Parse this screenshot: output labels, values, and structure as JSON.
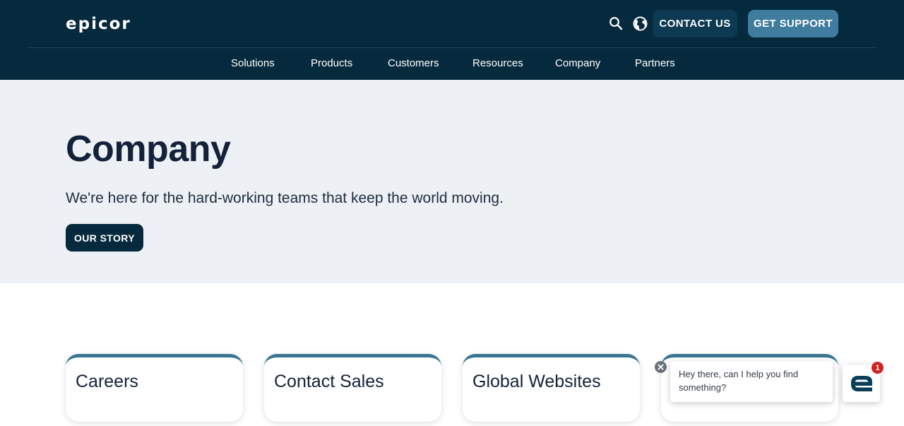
{
  "header": {
    "logo_text": "epicor",
    "contact_label": "CONTACT US",
    "support_label": "GET SUPPORT",
    "search_icon": "search-icon",
    "globe_icon": "globe-icon"
  },
  "nav": {
    "items": [
      {
        "label": "Solutions"
      },
      {
        "label": "Products"
      },
      {
        "label": "Customers"
      },
      {
        "label": "Resources"
      },
      {
        "label": "Company"
      },
      {
        "label": "Partners"
      }
    ]
  },
  "hero": {
    "title": "Company",
    "subtitle": "We're here for the hard-working teams that keep the world moving.",
    "cta_label": "OUR STORY"
  },
  "cards": [
    {
      "title": "Careers"
    },
    {
      "title": "Contact Sales"
    },
    {
      "title": "Global Websites"
    },
    {
      "title": ""
    }
  ],
  "chat": {
    "message": "Hey there, can I help you find something?",
    "badge_count": "1",
    "close_icon": "close-icon",
    "launcher_icon": "epicor-e-icon"
  },
  "colors": {
    "header_bg": "#062a3d",
    "hero_bg": "#edf1f5",
    "support_button": "#3f7c9e",
    "card_accent": "#3a7592",
    "badge": "#cf2222"
  }
}
